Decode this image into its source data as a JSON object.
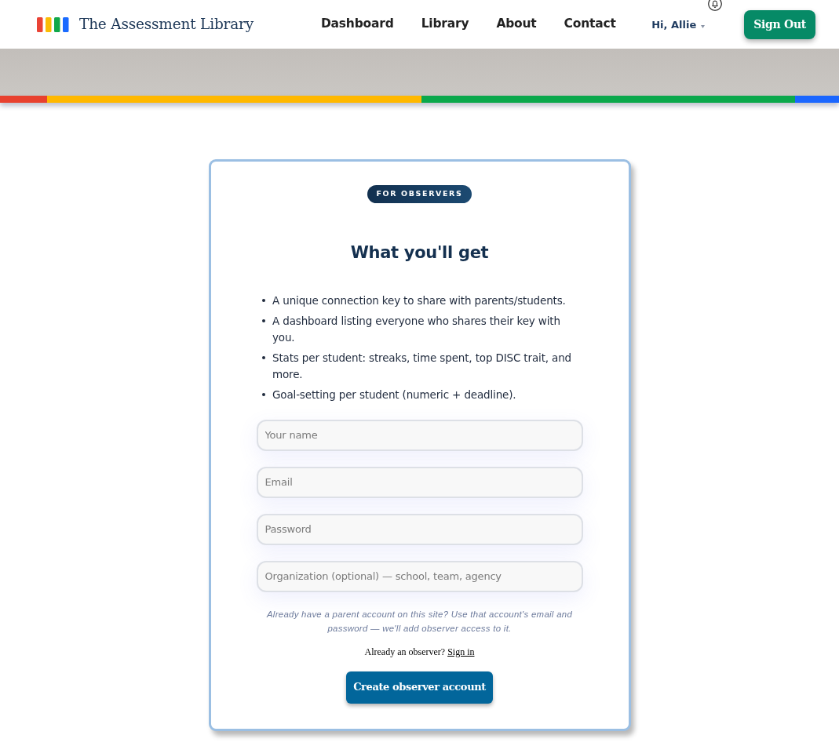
{
  "header": {
    "title": "The Assessment Library",
    "nav": [
      {
        "label": "Dashboard"
      },
      {
        "label": "Library"
      },
      {
        "label": "About"
      },
      {
        "label": "Contact"
      }
    ],
    "user_menu": "Hi, Allie",
    "sign_out": "Sign Out"
  },
  "card": {
    "badge": "FOR OBSERVERS",
    "heading": "What you'll get",
    "features": [
      "A unique connection key to share with parents/students.",
      "A dashboard listing everyone who shares their key with you.",
      "Stats per student: streaks, time spent, top DISC trait, and more.",
      "Goal-setting per student (numeric + deadline)."
    ],
    "fields": [
      {
        "placeholder": "Your name"
      },
      {
        "placeholder": "Email"
      },
      {
        "placeholder": "Password"
      },
      {
        "placeholder": "Organization (optional) — school, team, agency"
      }
    ],
    "note": "Already have a parent account on this site? Use that account's email and password — we'll add observer access to it.",
    "signin_prompt": "Already an observer?",
    "signin_link": "Sign in",
    "submit": "Create observer account"
  }
}
